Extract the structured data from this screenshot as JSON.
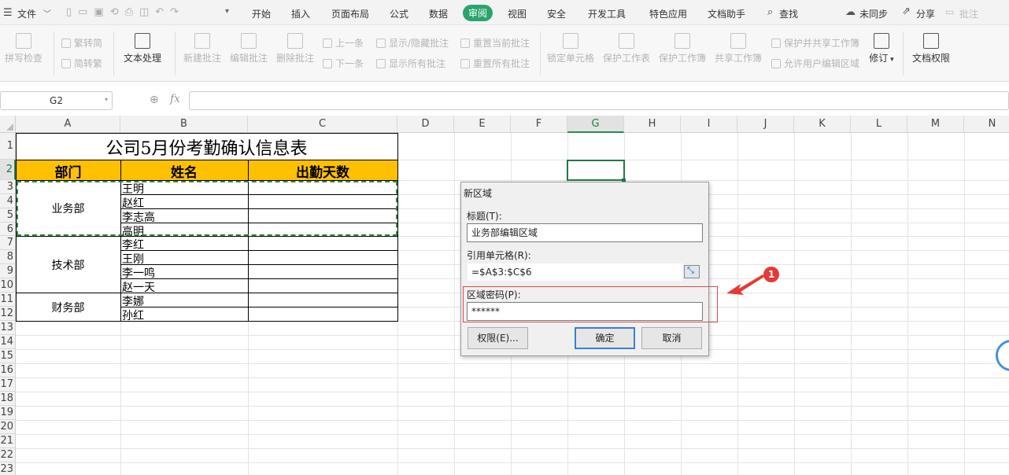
{
  "menubar": {
    "file_label": "文件",
    "tabs": [
      "开始",
      "插入",
      "页面布局",
      "公式",
      "数据",
      "审阅",
      "视图",
      "安全",
      "开发工具",
      "特色应用",
      "文档助手"
    ],
    "active_tab": "审阅",
    "search_label": "查找",
    "sync_label": "未同步",
    "share_label": "分享",
    "comment_label": "批注"
  },
  "ribbon": {
    "spell_check": "拼写检查",
    "to_traditional": "繁转简",
    "to_simplified": "简转繁",
    "text_process": "文本处理",
    "new_comment": "新建批注",
    "edit_comment": "编辑批注",
    "delete_comment": "删除批注",
    "prev": "上一条",
    "next": "下一条",
    "show_hide_comment": "显示/隐藏批注",
    "show_all_comments": "显示所有批注",
    "reset_current_comment": "重置当前批注",
    "reset_all_comments": "重置所有批注",
    "lock_cell": "锁定单元格",
    "protect_sheet": "保护工作表",
    "protect_workbook": "保护工作簿",
    "share_workbook": "共享工作簿",
    "protect_share_workbook": "保护并共享工作簿",
    "allow_edit_ranges": "允许用户编辑区域",
    "revise": "修订",
    "doc_permission": "文档权限"
  },
  "formula": {
    "name_box": "G2",
    "fx_label": "fx",
    "value": ""
  },
  "sheet": {
    "columns": [
      "A",
      "B",
      "C",
      "D",
      "E",
      "F",
      "G",
      "H",
      "I",
      "J",
      "K",
      "L",
      "M",
      "N"
    ],
    "selected_column": "G",
    "rows": [
      "1",
      "2",
      "3",
      "4",
      "5",
      "6",
      "7",
      "8",
      "9",
      "10",
      "11",
      "12",
      "13",
      "14",
      "15",
      "16",
      "17",
      "18",
      "19",
      "20",
      "21",
      "22",
      "23"
    ],
    "title": "公司5月份考勤确认信息表",
    "headers": [
      "部门",
      "姓名",
      "出勤天数"
    ],
    "header_color": "#ffc000",
    "departments": [
      "业务部",
      "技术部",
      "财务部"
    ],
    "names": [
      "王明",
      "赵红",
      "李志高",
      "高明",
      "李红",
      "王刚",
      "李一鸣",
      "赵一天",
      "李娜",
      "孙红"
    ]
  },
  "dialog": {
    "title": "新区域",
    "title_label": "标题(T):",
    "title_value": "业务部编辑区域",
    "ref_label": "引用单元格(R):",
    "ref_value": "=$A$3:$C$6",
    "password_label": "区域密码(P):",
    "password_value": "******",
    "permission_button": "权限(E)...",
    "ok_button": "确定",
    "cancel_button": "取消"
  },
  "annotation": {
    "badge": "1",
    "color": "#e53935"
  }
}
